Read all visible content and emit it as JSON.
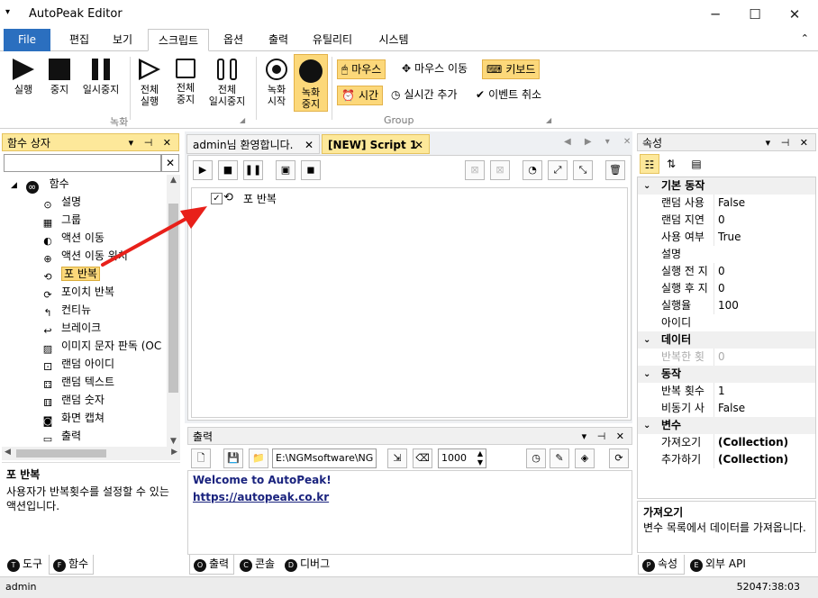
{
  "window": {
    "title": "AutoPeak Editor",
    "controls": [
      "─",
      "☐",
      "✕"
    ]
  },
  "menu": {
    "file": "File",
    "tabs": [
      "편집",
      "보기",
      "스크립트",
      "옵션",
      "출력",
      "유틸리티",
      "시스템"
    ],
    "active": "스크립트"
  },
  "ribbon": {
    "record_group": "녹화",
    "other_group": "Group",
    "buttons": [
      {
        "l1": "실행",
        "l2": ""
      },
      {
        "l1": "중지",
        "l2": ""
      },
      {
        "l1": "일시중지",
        "l2": ""
      },
      {
        "l1": "전체",
        "l2": "실행"
      },
      {
        "l1": "전체",
        "l2": "중지"
      },
      {
        "l1": "전체",
        "l2": "일시중지"
      },
      {
        "l1": "녹화",
        "l2": "시작"
      },
      {
        "l1": "녹화",
        "l2": "중지"
      }
    ],
    "options": {
      "mouse": "마우스",
      "mouse_move": "마우스 이동",
      "keyboard": "키보드",
      "time": "시간",
      "realtime_add": "실시간 추가",
      "event_cancel": "이벤트 취소"
    }
  },
  "left_panel": {
    "title": "함수 상자",
    "root": "함수",
    "items": [
      "설명",
      "그룹",
      "액션 이동",
      "액션 이동 위치",
      "포 반복",
      "포이치 반복",
      "컨티뉴",
      "브레이크",
      "이미지 문자 판독 (OC",
      "랜덤 아이디",
      "랜덤 텍스트",
      "랜덤 숫자",
      "화면 캡쳐",
      "출력"
    ],
    "selected": "포 반복",
    "desc_title": "포 반복",
    "desc_text": "사용자가 반복횟수를 설정할 수 있는 액션입니다.",
    "tabs": [
      {
        "badge": "T",
        "label": "도구"
      },
      {
        "badge": "F",
        "label": "함수"
      }
    ]
  },
  "document": {
    "tabs": [
      "admin님 환영합니다.",
      "[NEW] Script 1"
    ],
    "active_tab": "[NEW] Script 1",
    "script_item": "포 반복"
  },
  "output": {
    "title": "출력",
    "path": "E:\\NGMsoftware\\NG",
    "count": "1000",
    "welcome": "Welcome to AutoPeak!",
    "link": "https://autopeak.co.kr",
    "tabs": [
      {
        "badge": "O",
        "label": "출력"
      },
      {
        "badge": "C",
        "label": "콘솔"
      },
      {
        "badge": "D",
        "label": "디버그"
      }
    ]
  },
  "properties": {
    "title": "속성",
    "rows": [
      {
        "type": "cat",
        "k": "기본 동작"
      },
      {
        "k": "랜덤 사용",
        "v": "False"
      },
      {
        "k": "랜덤 지연",
        "v": "0"
      },
      {
        "k": "사용 여부",
        "v": "True"
      },
      {
        "k": "설명",
        "v": ""
      },
      {
        "k": "실행 전 지",
        "v": "0"
      },
      {
        "k": "실행 후 지",
        "v": "0"
      },
      {
        "k": "실행율",
        "v": "100"
      },
      {
        "k": "아이디",
        "v": ""
      },
      {
        "type": "cat",
        "k": "데이터"
      },
      {
        "k": "반복한 횟",
        "v": "0",
        "dim": true
      },
      {
        "type": "cat",
        "k": "동작"
      },
      {
        "k": "반복 횟수",
        "v": "1"
      },
      {
        "k": "비동기 사",
        "v": "False"
      },
      {
        "type": "cat",
        "k": "변수"
      },
      {
        "k": "가져오기",
        "v": "(Collection)",
        "bold": true
      },
      {
        "k": "추가하기",
        "v": "(Collection)",
        "bold": true
      }
    ],
    "desc_title": "가져오기",
    "desc_text": "변수 목록에서 데이터를 가져옵니다.",
    "tabs": [
      {
        "badge": "P",
        "label": "속성"
      },
      {
        "badge": "E",
        "label": "외부 API"
      }
    ]
  },
  "status": {
    "user": "admin",
    "time": "52047:38:03"
  },
  "colors": {
    "accent": "#2b6fbf",
    "highlight": "#fcd87a",
    "link": "#1a237e",
    "arrow": "#e8201a"
  }
}
